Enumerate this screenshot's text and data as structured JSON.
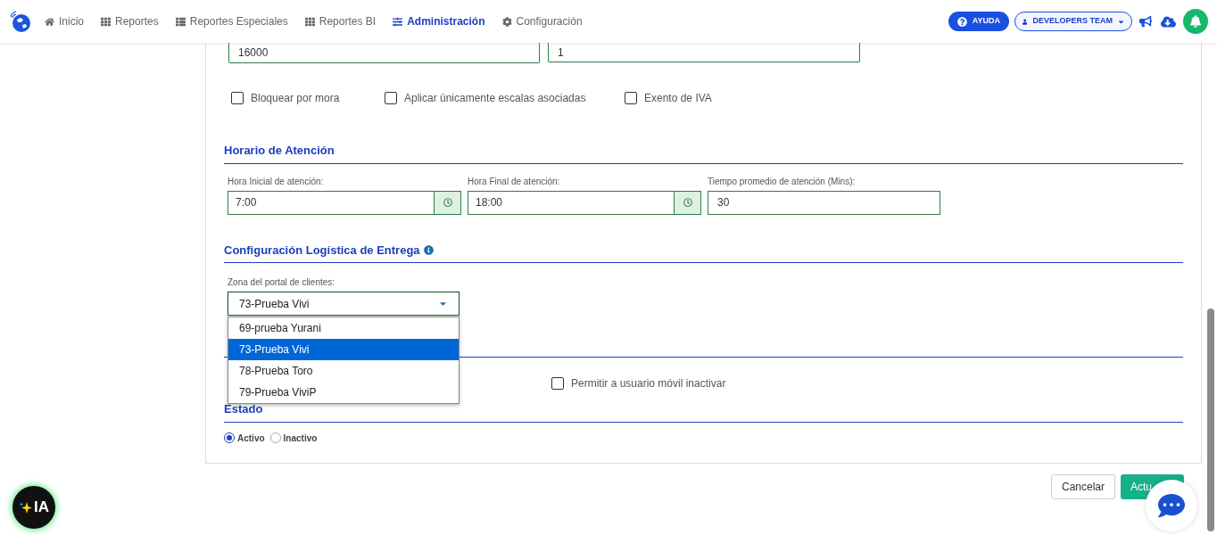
{
  "nav": {
    "items": [
      {
        "label": "Inicio",
        "selected": false
      },
      {
        "label": "Reportes",
        "selected": false
      },
      {
        "label": "Reportes Especiales",
        "selected": false
      },
      {
        "label": "Reportes BI",
        "selected": false
      },
      {
        "label": "Administración",
        "selected": true
      },
      {
        "label": "Configuración",
        "selected": false
      }
    ],
    "help_button": "AYUDA",
    "team_selector": "DEVELOPERS TEAM"
  },
  "top_fields": [
    {
      "value": "16000"
    },
    {
      "value": "1"
    }
  ],
  "options": [
    {
      "label": "Bloquear por mora",
      "checked": false
    },
    {
      "label": "Aplicar únicamente escalas asociadas",
      "checked": false
    },
    {
      "label": "Exento de IVA",
      "checked": false
    }
  ],
  "schedule": {
    "title": "Horario de Atención",
    "fields": [
      {
        "label": "Hora Inicial de atención:",
        "value": "7:00",
        "kind": "time"
      },
      {
        "label": "Hora Final de atención:",
        "value": "18:00",
        "kind": "time"
      },
      {
        "label": "Tiempo promedio de atención (Mins):",
        "value": "30",
        "kind": "text"
      }
    ]
  },
  "logistics": {
    "title": "Configuración Logística de Entrega",
    "zone_label": "Zona del portal de clientes:",
    "zone_value": "73-Prueba Vivi",
    "expanded": true,
    "zone_options": [
      {
        "label": "69-prueba Yurani",
        "selected": false
      },
      {
        "label": "73-Prueba Vivi",
        "selected": true
      },
      {
        "label": "78-Prueba Toro",
        "selected": false
      },
      {
        "label": "79-Prueba ViviP",
        "selected": false
      }
    ]
  },
  "mobile_option": {
    "label": "Permitir a usuario móvil inactivar",
    "checked": false
  },
  "status": {
    "title": "Estado",
    "choices": [
      {
        "label": "Activo",
        "selected": true
      },
      {
        "label": "Inactivo",
        "selected": false
      }
    ]
  },
  "buttons": {
    "cancel": "Cancelar",
    "submit": "Actu"
  },
  "ai_badge": "IA"
}
